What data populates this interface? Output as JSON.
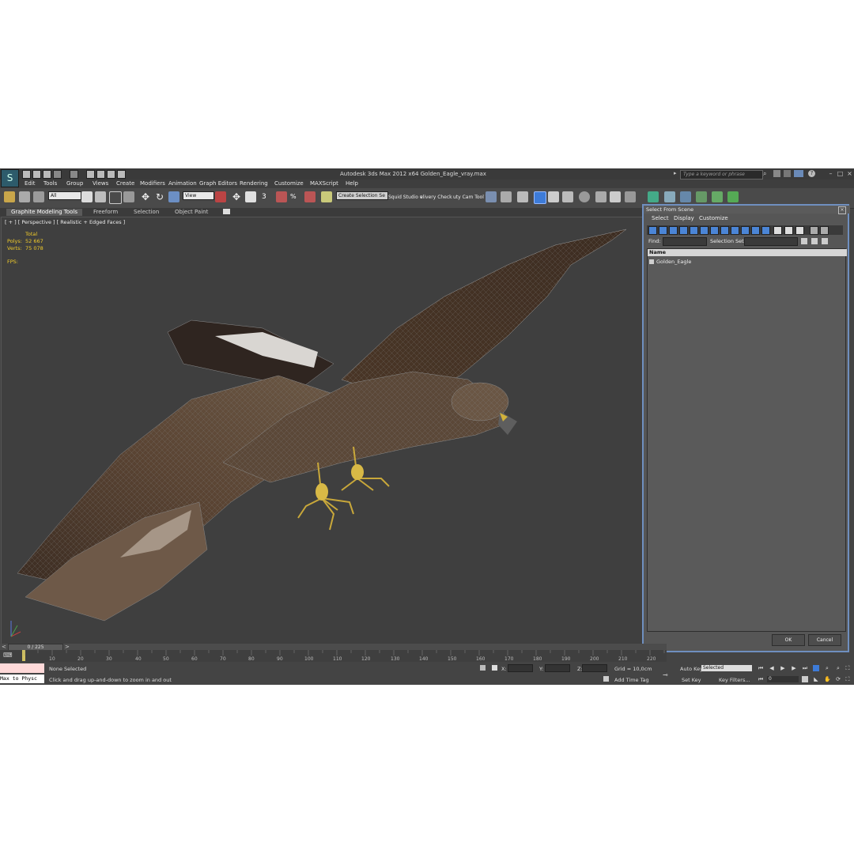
{
  "window": {
    "title": "Autodesk 3ds Max  2012 x64      Golden_Eagle_vray.max",
    "search_placeholder": "Type a keyword or phrase",
    "logo": "3ds-max-logo"
  },
  "menu": [
    "Edit",
    "Tools",
    "Group",
    "Views",
    "Create",
    "Modifiers",
    "Animation",
    "Graph Editors",
    "Rendering",
    "Customize",
    "MAXScript",
    "Help"
  ],
  "toolbar": {
    "selection_filter": "All",
    "reference_coord": "View",
    "named_selection": "Create Selection Se",
    "plugin_1": "Squid Studio v",
    "plugin_2": "elivery Check",
    "plugin_3": "uty Cam Tool \\"
  },
  "ribbon": {
    "tabs": [
      "Graphite Modeling Tools",
      "Freeform",
      "Selection",
      "Object Paint"
    ]
  },
  "viewport": {
    "label": "[ + ] [ Perspective ] [ Realistic + Edged Faces ]",
    "stats_header": "Total",
    "polys_label": "Polys:",
    "polys_value": "52 667",
    "verts_label": "Verts:",
    "verts_value": "75 078",
    "fps_label": "FPS:"
  },
  "dialog": {
    "title": "Select From Scene",
    "menu": [
      "Select",
      "Display",
      "Customize"
    ],
    "find_label": "Find:",
    "selection_set_label": "Selection Set:",
    "column_name": "Name",
    "items": [
      "Golden_Eagle"
    ],
    "ok": "OK",
    "cancel": "Cancel"
  },
  "timeline": {
    "frame_display": "0 / 225",
    "ticks": [
      "10",
      "20",
      "30",
      "40",
      "50",
      "60",
      "70",
      "80",
      "90",
      "100",
      "110",
      "120",
      "130",
      "140",
      "150",
      "160",
      "170",
      "180",
      "190",
      "200",
      "210",
      "220"
    ]
  },
  "status": {
    "maxscript_listener": "Max to Physc",
    "selection": "None Selected",
    "prompt": "Click and drag up-and-down to zoom in and out",
    "x_label": "X:",
    "y_label": "Y:",
    "z_label": "Z:",
    "grid": "Grid = 10,0cm",
    "add_time_tag": "Add Time Tag",
    "auto_key": "Auto Key",
    "set_key": "Set Key",
    "key_mode": "Selected",
    "key_filters": "Key Filters...",
    "current_frame": "0"
  },
  "colors": {
    "stats_yellow": "#f2cc2a",
    "dialog_border": "#6f8fbf",
    "active_blue": "#3d7bd8"
  }
}
